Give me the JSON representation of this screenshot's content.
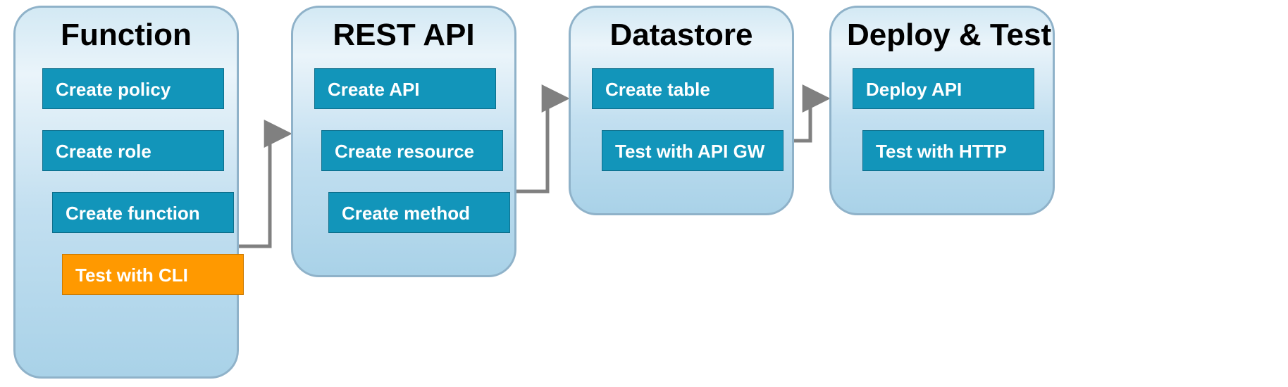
{
  "colors": {
    "teal": "#1295ba",
    "orange": "#ff9900",
    "panel_border": "#8fb2c9",
    "arrow": "#808080"
  },
  "panels": [
    {
      "title": "Function",
      "steps": [
        {
          "label": "Create policy",
          "color": "teal"
        },
        {
          "label": "Create role",
          "color": "teal"
        },
        {
          "label": "Create function",
          "color": "teal"
        },
        {
          "label": "Test with CLI",
          "color": "orange"
        }
      ]
    },
    {
      "title": "REST API",
      "steps": [
        {
          "label": "Create API",
          "color": "teal"
        },
        {
          "label": "Create resource",
          "color": "teal"
        },
        {
          "label": "Create method",
          "color": "teal"
        }
      ]
    },
    {
      "title": "Datastore",
      "steps": [
        {
          "label": "Create table",
          "color": "teal"
        },
        {
          "label": "Test with API GW",
          "color": "teal"
        }
      ]
    },
    {
      "title": "Deploy & Test",
      "steps": [
        {
          "label": "Deploy API",
          "color": "teal"
        },
        {
          "label": "Test with HTTP",
          "color": "teal"
        }
      ]
    }
  ],
  "flow": [
    {
      "from": "Function",
      "to": "REST API"
    },
    {
      "from": "REST API",
      "to": "Datastore"
    },
    {
      "from": "Datastore",
      "to": "Deploy & Test"
    }
  ]
}
